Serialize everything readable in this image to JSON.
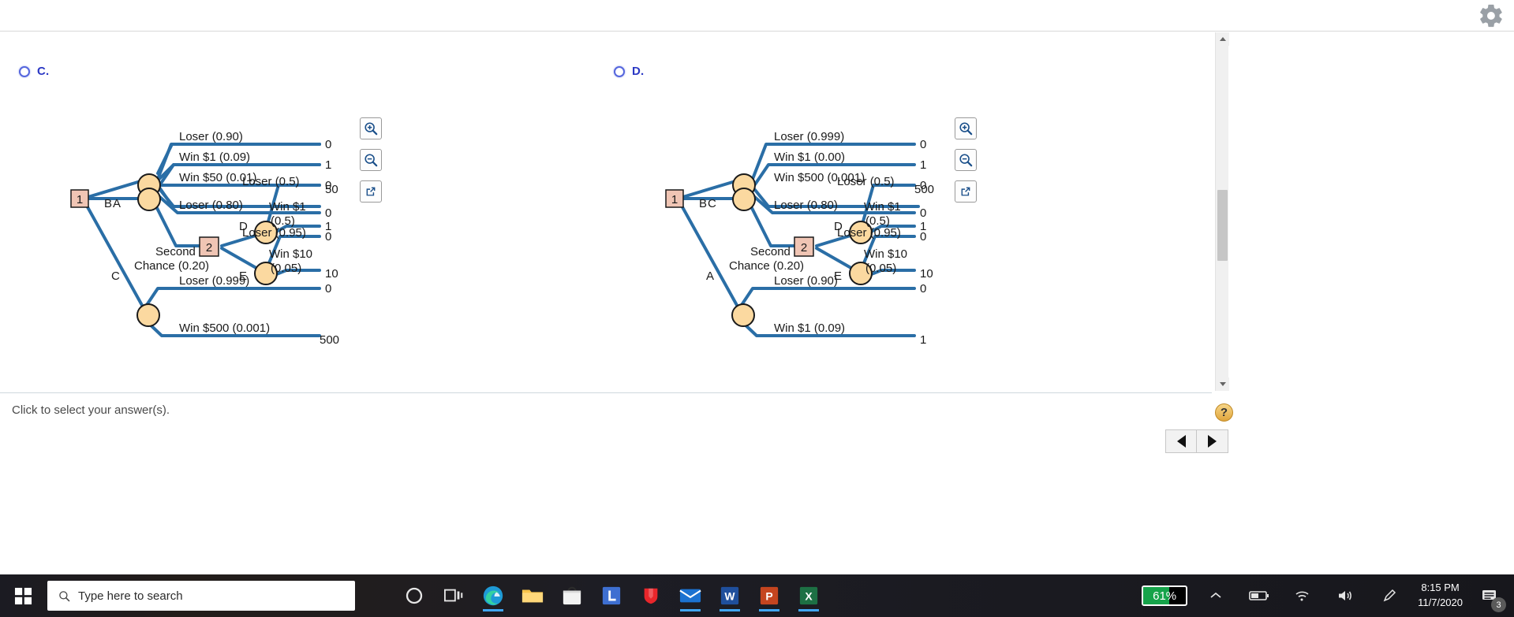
{
  "window": {
    "gear_icon": "gear-icon"
  },
  "prompt_text": "Click to select your answer(s).",
  "help_glyph": "?",
  "toolbar": {
    "zoom_in": "zoom-in-icon",
    "zoom_out": "zoom-out-icon",
    "open_external": "open-external-icon"
  },
  "nav": {
    "prev": "previous-question",
    "next": "next-question"
  },
  "options": [
    {
      "id": "C",
      "label": "C.",
      "tree": {
        "root": "1",
        "decision2": "2",
        "branches": {
          "top": "A",
          "middle": "B",
          "bottom": "C",
          "second_chance": "Second\nChance (0.20)",
          "sub_top": "D",
          "sub_bottom": "E"
        },
        "top_group": [
          {
            "label": "Loser (0.90)",
            "payoff": "0"
          },
          {
            "label": "Win $1 (0.09)",
            "payoff": "1"
          },
          {
            "label": "Win $50 (0.01)",
            "payoff": "50"
          }
        ],
        "middle_loser": {
          "label": "Loser (0.80)",
          "payoff": "0"
        },
        "second_chance_label": "Second",
        "second_chance_label2": "Chance (0.20)",
        "d_group": [
          {
            "label": "Loser (0.5)",
            "payoff": "0"
          },
          {
            "label": "Win $1",
            "label2": "(0.5)",
            "payoff": "1"
          }
        ],
        "e_group": [
          {
            "label": "Loser (0.95)",
            "payoff": "0"
          },
          {
            "label": "Win $10",
            "label2": "(0.05)",
            "payoff": "10"
          }
        ],
        "bottom_group": [
          {
            "label": "Loser (0.999)",
            "payoff": "0"
          },
          {
            "label": "Win $500 (0.001)",
            "payoff": "500"
          }
        ]
      }
    },
    {
      "id": "D",
      "label": "D.",
      "tree": {
        "root": "1",
        "decision2": "2",
        "branches": {
          "top": "C",
          "middle": "B",
          "bottom": "A",
          "sub_top": "D",
          "sub_bottom": "E"
        },
        "top_group": [
          {
            "label": "Loser (0.999)",
            "payoff": "0"
          },
          {
            "label": "Win $1 (0.00)",
            "payoff": "1"
          },
          {
            "label": "Win $500 (0.001)",
            "payoff": "500"
          }
        ],
        "middle_loser": {
          "label": "Loser (0.80)",
          "payoff": "0"
        },
        "second_chance_label": "Second",
        "second_chance_label2": "Chance (0.20)",
        "d_group": [
          {
            "label": "Loser (0.5)",
            "payoff": "0"
          },
          {
            "label": "Win $1",
            "label2": "(0.5)",
            "payoff": "1"
          }
        ],
        "e_group": [
          {
            "label": "Loser (0.95)",
            "payoff": "0"
          },
          {
            "label": "Win $10",
            "label2": "(0.05)",
            "payoff": "10"
          }
        ],
        "bottom_group": [
          {
            "label": "Loser (0.90)",
            "payoff": "0"
          },
          {
            "label": "Win $1 (0.09)",
            "payoff": "1"
          }
        ]
      }
    }
  ],
  "colors": {
    "branch": "#2a6ea6",
    "chance_node": "#fbd9a0",
    "decision_node": "#f0c5b4",
    "option_label": "#2b38c4",
    "battery_green": "#16a34a"
  },
  "taskbar": {
    "search_placeholder": "Type here to search",
    "battery": "61%",
    "time": "8:15 PM",
    "date": "11/7/2020",
    "notification_count": "3",
    "apps": [
      {
        "name": "cortana-icon"
      },
      {
        "name": "task-view-icon"
      },
      {
        "name": "edge-icon"
      },
      {
        "name": "file-explorer-icon"
      },
      {
        "name": "store-icon"
      },
      {
        "name": "lockdown-browser-icon"
      },
      {
        "name": "shield-app-icon"
      },
      {
        "name": "mail-icon"
      },
      {
        "name": "word-icon"
      },
      {
        "name": "powerpoint-icon"
      },
      {
        "name": "excel-icon"
      }
    ],
    "tray": [
      {
        "name": "show-hidden-icons-chevron"
      },
      {
        "name": "battery-icon"
      },
      {
        "name": "wifi-icon"
      },
      {
        "name": "volume-icon"
      },
      {
        "name": "pen-icon"
      }
    ]
  }
}
